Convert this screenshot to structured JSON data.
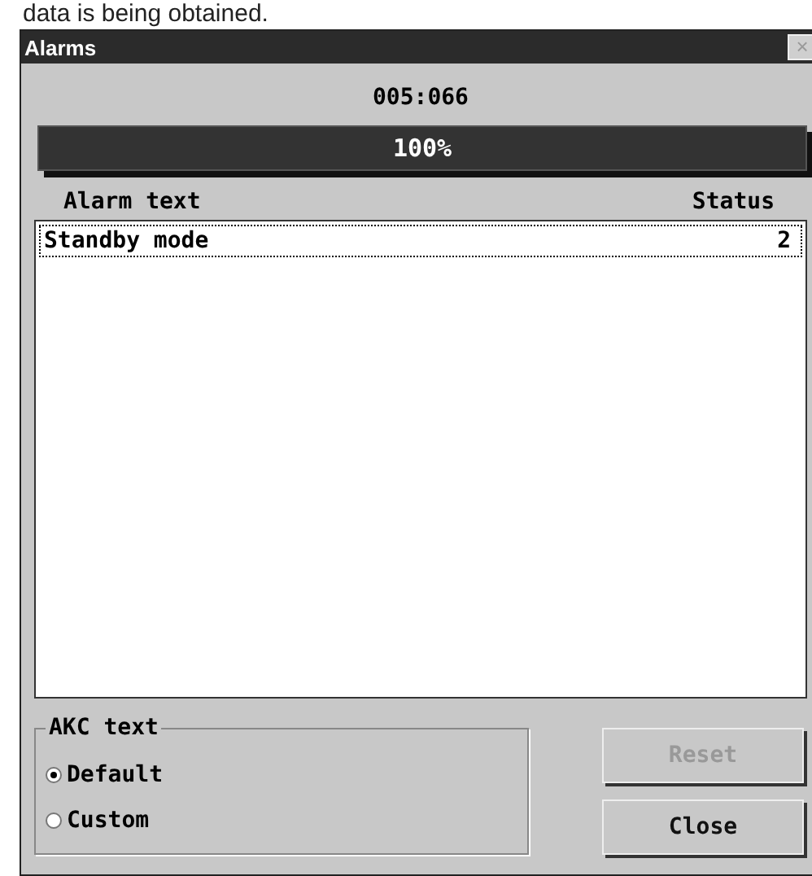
{
  "caption": "data is being obtained.",
  "window": {
    "title": "Alarms",
    "close": "×"
  },
  "counter": "005:066",
  "progress": {
    "level": 1,
    "reading": "100%"
  },
  "table": {
    "columns": [
      "Alarm text",
      "Status"
    ],
    "rows": [
      {
        "text": "Standby mode",
        "status": "2",
        "selected": true
      }
    ]
  },
  "akc_group": {
    "label": "AKC text",
    "options": [
      {
        "label": "Default",
        "selected": true
      },
      {
        "label": "Custom",
        "selected": false
      }
    ]
  },
  "buttons": [
    {
      "label": "Reset",
      "disabled": true
    },
    {
      "label": "Close",
      "disabled": false
    }
  ]
}
